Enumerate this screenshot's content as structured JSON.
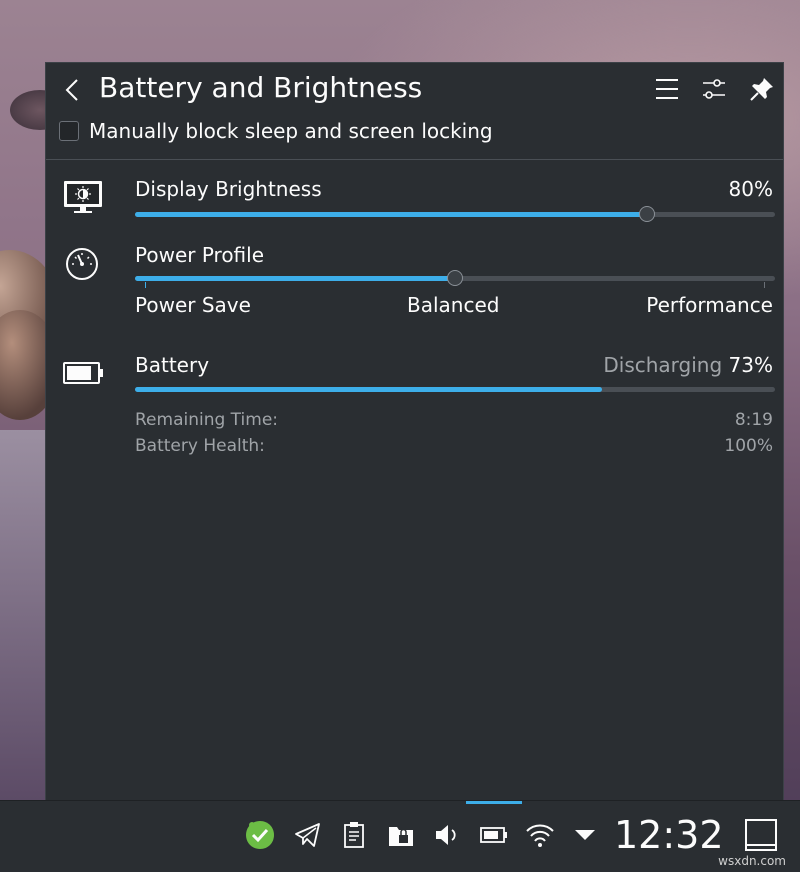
{
  "panel": {
    "title": "Battery and Brightness",
    "header_icons": [
      "back-icon",
      "hamburger-menu-icon",
      "settings-sliders-icon",
      "pin-icon"
    ],
    "inhibit_checkbox": {
      "label": "Manually block sleep and screen locking",
      "checked": false
    }
  },
  "brightness": {
    "label": "Display Brightness",
    "value_text": "80%",
    "value": 0.8,
    "icon": "display-brightness-icon"
  },
  "power_profile": {
    "label": "Power Profile",
    "icon": "speedometer-icon",
    "options": [
      "Power Save",
      "Balanced",
      "Performance"
    ],
    "selected": "Balanced",
    "selected_index": 1
  },
  "battery": {
    "label": "Battery",
    "icon": "battery-icon",
    "status": "Discharging",
    "percent_text": "73%",
    "charge": 0.73,
    "remaining_label": "Remaining Time:",
    "remaining_value": "8:19",
    "health_label": "Battery Health:",
    "health_value": "100%"
  },
  "taskbar": {
    "clock": "12:32",
    "tray_icons": [
      "update-check-icon",
      "telegram-icon",
      "clipboard-icon",
      "vault-icon",
      "volume-icon",
      "battery-icon",
      "wifi-icon",
      "expand-arrow-icon",
      "show-desktop-icon"
    ],
    "accent": "#3daee9"
  },
  "watermark": "wsxdn.com",
  "colors": {
    "accent": "#3daee9",
    "panel_bg": "#2a2e32",
    "text": "#fcfcfc",
    "muted": "#a0a4a8",
    "tray_check": "#6cbd45"
  }
}
